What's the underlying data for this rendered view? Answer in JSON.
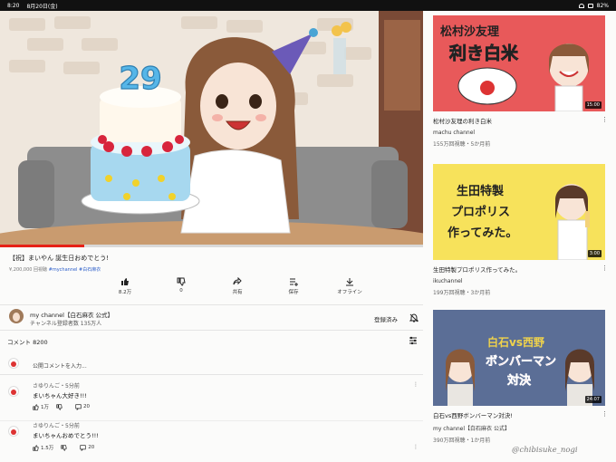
{
  "status_bar": {
    "time": "8:20",
    "date": "8月20日(金)",
    "battery": "82%"
  },
  "video": {
    "title": "【祝】まいやん 誕生日おめでとう!",
    "views": "¥,200,000 回視聴",
    "hashtags": "#mychannel #白石麻衣",
    "cake_number": "29",
    "progress": 0.2
  },
  "actions": [
    {
      "icon": "thumbs-up-icon",
      "label": "8.2万"
    },
    {
      "icon": "thumbs-down-icon",
      "label": "0"
    },
    {
      "icon": "share-icon",
      "label": "共有"
    },
    {
      "icon": "save-icon",
      "label": "保存"
    },
    {
      "icon": "download-icon",
      "label": "オフライン"
    }
  ],
  "channel": {
    "name": "my channel【白石麻衣 公式】",
    "subscribers": "チャンネル登録者数 135万人",
    "subscribed_label": "登録済み"
  },
  "comments": {
    "header": "コメント 8200",
    "add_placeholder": "公開コメントを入力...",
    "items": [
      {
        "author": "さゆりんご・5分前",
        "text": "まいちゃん大好き!!!",
        "likes": "1万",
        "replies": "20"
      },
      {
        "author": "さゆりんご・5分前",
        "text": "まいちゃんおめでとう!!!",
        "likes": "1.5万",
        "replies": "20"
      }
    ]
  },
  "recommendations": [
    {
      "thumb_title_line1": "松村沙友理",
      "thumb_title_line2": "利き白米",
      "duration": "15:00",
      "title": "松村沙友理の利き白米",
      "channel": "machu channel",
      "stats": "155万回視聴・5か月前",
      "bg": "#e8595a"
    },
    {
      "thumb_lines": [
        "生田特製",
        "プロポリス",
        "作ってみた。"
      ],
      "duration": "3:00",
      "title": "生田特製プロポリス作ってみた。",
      "channel": "ikuchannel",
      "stats": "199万回視聴・3か月前",
      "bg": "#f7e25b"
    },
    {
      "thumb_line1": "白石vs西野",
      "thumb_line2": "ボンバーマン",
      "thumb_line3": "対決",
      "duration": "24:07",
      "title": "白石vs西野ボンバーマン対決!",
      "channel": "my channel【白石麻衣 公式】",
      "stats": "390万回視聴・1か月前",
      "bg": "#5b6e96"
    }
  ],
  "watermark": "@chibisuke_nogi"
}
